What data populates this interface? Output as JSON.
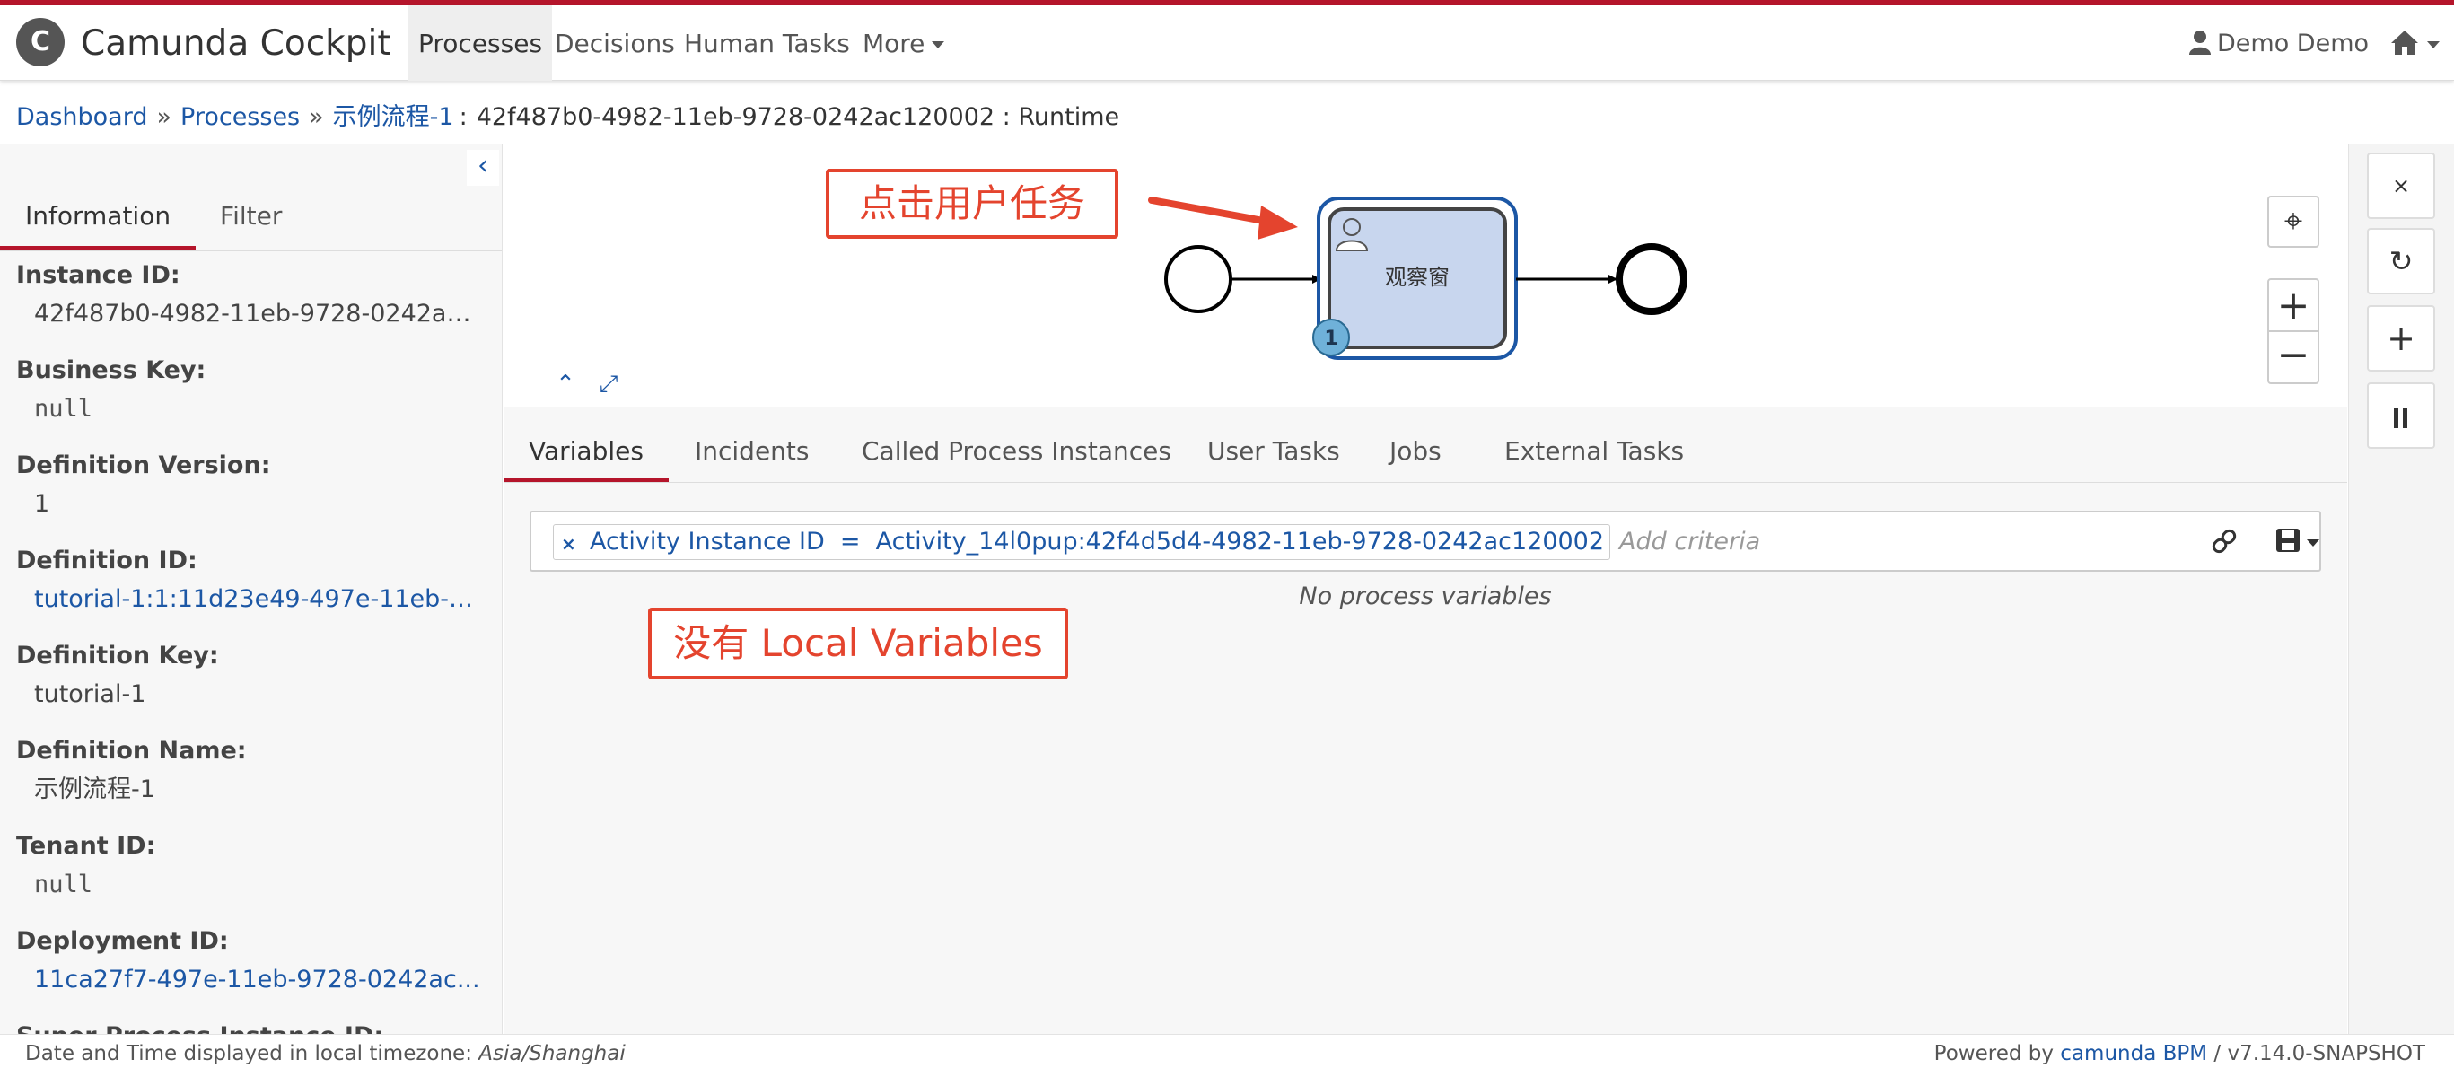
{
  "brand": {
    "logo_letter": "C",
    "name": "Camunda Cockpit"
  },
  "nav": {
    "items": [
      {
        "label": "Processes"
      },
      {
        "label": "Decisions"
      },
      {
        "label": "Human Tasks"
      },
      {
        "label": "More"
      }
    ],
    "user": "Demo Demo"
  },
  "breadcrumb": {
    "dashboard": "Dashboard",
    "sep1": "»",
    "processes": "Processes",
    "sep2": "»",
    "process_name": "示例流程-1",
    "colon": ":",
    "instance": "42f487b0-4982-11eb-9728-0242ac120002 : Runtime"
  },
  "sidebar": {
    "tabs": [
      "Information",
      "Filter"
    ],
    "fields": [
      {
        "label": "Instance ID:",
        "value": "42f487b0-4982-11eb-9728-0242ac..."
      },
      {
        "label": "Business Key:",
        "value": "null"
      },
      {
        "label": "Definition Version:",
        "value": "1"
      },
      {
        "label": "Definition ID:",
        "value": "tutorial-1:1:11d23e49-497e-11eb-9..."
      },
      {
        "label": "Definition Key:",
        "value": "tutorial-1"
      },
      {
        "label": "Definition Name:",
        "value": "示例流程-1"
      },
      {
        "label": "Tenant ID:",
        "value": "null"
      },
      {
        "label": "Deployment ID:",
        "value": "11ca27f7-497e-11eb-9728-0242ac..."
      },
      {
        "label": "Super Process Instance ID:",
        "value": ""
      }
    ]
  },
  "diagram": {
    "task_label": "观察窗",
    "badge": "1",
    "annotation": "点击用户任务"
  },
  "right_bar": {
    "close": "×"
  },
  "tabs": [
    "Variables",
    "Incidents",
    "Called Process Instances",
    "User Tasks",
    "Jobs",
    "External Tasks"
  ],
  "search": {
    "pill_remove": "×",
    "pill_text": "Activity Instance ID  =  Activity_14l0pup:42f4d5d4-4982-11eb-9728-0242ac120002",
    "placeholder": "Add criteria"
  },
  "empty_text": "No process variables",
  "annotation2": "没有 Local Variables",
  "footer": {
    "tz_prefix": "Date and Time displayed in local timezone: ",
    "tz": "Asia/Shanghai",
    "powered": "Powered by ",
    "product": "camunda BPM",
    "version": " / v7.14.0-SNAPSHOT"
  },
  "colors": {
    "accent": "#b5152b",
    "link": "#1c57a5",
    "annotation": "#e4442e",
    "task_fill": "#c8d6ee"
  }
}
